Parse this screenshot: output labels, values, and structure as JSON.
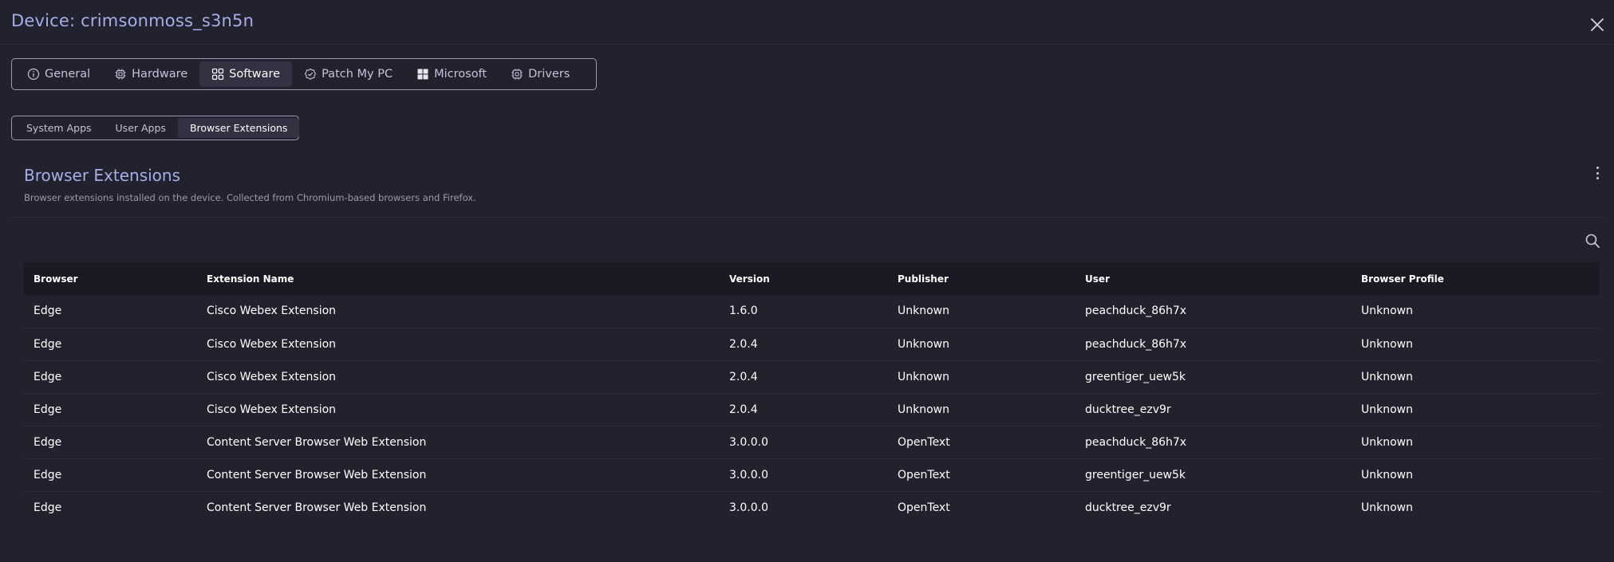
{
  "window": {
    "title": "Device: crimsonmoss_s3n5n"
  },
  "main_tabs": [
    {
      "label": "General",
      "icon": "info-icon"
    },
    {
      "label": "Hardware",
      "icon": "chip-icon"
    },
    {
      "label": "Software",
      "icon": "apps-grid-icon",
      "active": true
    },
    {
      "label": "Patch My PC",
      "icon": "patch-icon"
    },
    {
      "label": "Microsoft",
      "icon": "windows-icon"
    },
    {
      "label": "Drivers",
      "icon": "driver-icon"
    }
  ],
  "sub_tabs": [
    {
      "label": "System Apps"
    },
    {
      "label": "User Apps"
    },
    {
      "label": "Browser Extensions",
      "active": true
    }
  ],
  "section": {
    "title": "Browser Extensions",
    "description": "Browser extensions installed on the device. Collected from Chromium-based browsers and Firefox."
  },
  "table": {
    "headers": [
      "Browser",
      "Extension Name",
      "Version",
      "Publisher",
      "User",
      "Browser Profile"
    ],
    "rows": [
      [
        "Edge",
        "Cisco Webex Extension",
        "1.6.0",
        "Unknown",
        "peachduck_86h7x",
        "Unknown"
      ],
      [
        "Edge",
        "Cisco Webex Extension",
        "2.0.4",
        "Unknown",
        "peachduck_86h7x",
        "Unknown"
      ],
      [
        "Edge",
        "Cisco Webex Extension",
        "2.0.4",
        "Unknown",
        "greentiger_uew5k",
        "Unknown"
      ],
      [
        "Edge",
        "Cisco Webex Extension",
        "2.0.4",
        "Unknown",
        "ducktree_ezv9r",
        "Unknown"
      ],
      [
        "Edge",
        "Content Server Browser Web Extension",
        "3.0.0.0",
        "OpenText",
        "peachduck_86h7x",
        "Unknown"
      ],
      [
        "Edge",
        "Content Server Browser Web Extension",
        "3.0.0.0",
        "OpenText",
        "greentiger_uew5k",
        "Unknown"
      ],
      [
        "Edge",
        "Content Server Browser Web Extension",
        "3.0.0.0",
        "OpenText",
        "ducktree_ezv9r",
        "Unknown"
      ]
    ]
  },
  "colors": {
    "background": "#22222f",
    "accent_title": "#a5aee6",
    "table_header_bg": "#1a1a24",
    "active_tab_bg": "#323242"
  }
}
